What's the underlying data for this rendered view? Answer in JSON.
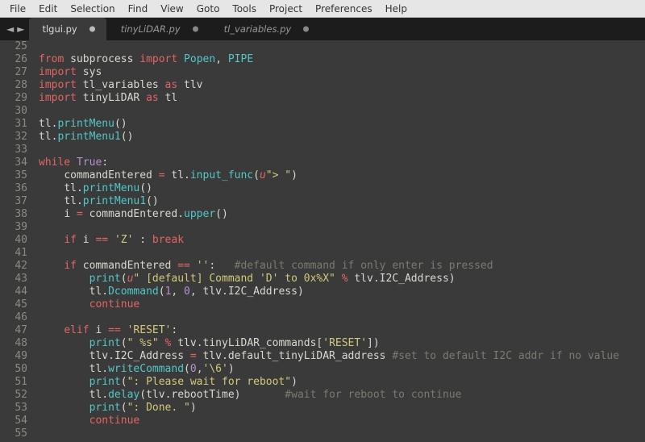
{
  "menubar": {
    "items": [
      "File",
      "Edit",
      "Selection",
      "Find",
      "View",
      "Goto",
      "Tools",
      "Project",
      "Preferences",
      "Help"
    ]
  },
  "tabbar": {
    "nav_left": "◄",
    "nav_right": "►",
    "tabs": [
      {
        "label": "tlgui.py",
        "active": true,
        "dirty": true
      },
      {
        "label": "tinyLiDAR.py",
        "active": false,
        "dirty": true
      },
      {
        "label": "tl_variables.py",
        "active": false,
        "dirty": true
      }
    ]
  },
  "editor": {
    "first_line_number": 25,
    "lines": [
      {
        "n": 25,
        "tokens": []
      },
      {
        "n": 26,
        "tokens": [
          {
            "t": "from ",
            "c": "kw"
          },
          {
            "t": "subprocess",
            "c": "id"
          },
          {
            "t": " import ",
            "c": "kw"
          },
          {
            "t": "Popen",
            "c": "cls"
          },
          {
            "t": ", ",
            "c": "id"
          },
          {
            "t": "PIPE",
            "c": "cls"
          }
        ]
      },
      {
        "n": 27,
        "tokens": [
          {
            "t": "import ",
            "c": "kw"
          },
          {
            "t": "sys",
            "c": "id"
          }
        ]
      },
      {
        "n": 28,
        "tokens": [
          {
            "t": "import ",
            "c": "kw"
          },
          {
            "t": "tl_variables",
            "c": "id"
          },
          {
            "t": " as ",
            "c": "kw"
          },
          {
            "t": "tlv",
            "c": "id"
          }
        ]
      },
      {
        "n": 29,
        "tokens": [
          {
            "t": "import ",
            "c": "kw"
          },
          {
            "t": "tinyLiDAR",
            "c": "id"
          },
          {
            "t": " as ",
            "c": "kw"
          },
          {
            "t": "tl",
            "c": "id"
          }
        ]
      },
      {
        "n": 30,
        "tokens": []
      },
      {
        "n": 31,
        "tokens": [
          {
            "t": "tl",
            "c": "id"
          },
          {
            "t": ".",
            "c": "id"
          },
          {
            "t": "printMenu",
            "c": "fnc"
          },
          {
            "t": "()",
            "c": "id"
          }
        ]
      },
      {
        "n": 32,
        "tokens": [
          {
            "t": "tl",
            "c": "id"
          },
          {
            "t": ".",
            "c": "id"
          },
          {
            "t": "printMenu1",
            "c": "fnc"
          },
          {
            "t": "()",
            "c": "id"
          }
        ]
      },
      {
        "n": 33,
        "tokens": []
      },
      {
        "n": 34,
        "tokens": [
          {
            "t": "while ",
            "c": "kw"
          },
          {
            "t": "True",
            "c": "cnst"
          },
          {
            "t": ":",
            "c": "id"
          }
        ]
      },
      {
        "n": 35,
        "tokens": [
          {
            "t": "    ",
            "c": "id"
          },
          {
            "t": "commandEntered",
            "c": "id"
          },
          {
            "t": " = ",
            "c": "op"
          },
          {
            "t": "tl",
            "c": "id"
          },
          {
            "t": ".",
            "c": "id"
          },
          {
            "t": "input_func",
            "c": "fnc"
          },
          {
            "t": "(",
            "c": "id"
          },
          {
            "t": "u",
            "c": "pfx"
          },
          {
            "t": "\"> \"",
            "c": "str"
          },
          {
            "t": ")",
            "c": "id"
          }
        ]
      },
      {
        "n": 36,
        "tokens": [
          {
            "t": "    ",
            "c": "id"
          },
          {
            "t": "tl",
            "c": "id"
          },
          {
            "t": ".",
            "c": "id"
          },
          {
            "t": "printMenu",
            "c": "fnc"
          },
          {
            "t": "()",
            "c": "id"
          }
        ]
      },
      {
        "n": 37,
        "tokens": [
          {
            "t": "    ",
            "c": "id"
          },
          {
            "t": "tl",
            "c": "id"
          },
          {
            "t": ".",
            "c": "id"
          },
          {
            "t": "printMenu1",
            "c": "fnc"
          },
          {
            "t": "()",
            "c": "id"
          }
        ]
      },
      {
        "n": 38,
        "tokens": [
          {
            "t": "    ",
            "c": "id"
          },
          {
            "t": "i",
            "c": "id"
          },
          {
            "t": " = ",
            "c": "op"
          },
          {
            "t": "commandEntered",
            "c": "id"
          },
          {
            "t": ".",
            "c": "id"
          },
          {
            "t": "upper",
            "c": "fnc"
          },
          {
            "t": "()",
            "c": "id"
          }
        ]
      },
      {
        "n": 39,
        "tokens": []
      },
      {
        "n": 40,
        "tokens": [
          {
            "t": "    ",
            "c": "id"
          },
          {
            "t": "if ",
            "c": "kw"
          },
          {
            "t": "i",
            "c": "id"
          },
          {
            "t": " == ",
            "c": "op"
          },
          {
            "t": "'Z'",
            "c": "str"
          },
          {
            "t": " : ",
            "c": "id"
          },
          {
            "t": "break",
            "c": "kw"
          }
        ]
      },
      {
        "n": 41,
        "tokens": []
      },
      {
        "n": 42,
        "tokens": [
          {
            "t": "    ",
            "c": "id"
          },
          {
            "t": "if ",
            "c": "kw"
          },
          {
            "t": "commandEntered",
            "c": "id"
          },
          {
            "t": " == ",
            "c": "op"
          },
          {
            "t": "''",
            "c": "str"
          },
          {
            "t": ":   ",
            "c": "id"
          },
          {
            "t": "#default command if only enter is pressed",
            "c": "cmt"
          }
        ]
      },
      {
        "n": 43,
        "tokens": [
          {
            "t": "        ",
            "c": "id"
          },
          {
            "t": "print",
            "c": "fnc"
          },
          {
            "t": "(",
            "c": "id"
          },
          {
            "t": "u",
            "c": "pfx"
          },
          {
            "t": "\" [default] Command 'D' to 0x%X\"",
            "c": "str"
          },
          {
            "t": " % ",
            "c": "op"
          },
          {
            "t": "tlv",
            "c": "id"
          },
          {
            "t": ".",
            "c": "id"
          },
          {
            "t": "I2C_Address",
            "c": "id"
          },
          {
            "t": ")",
            "c": "id"
          }
        ]
      },
      {
        "n": 44,
        "tokens": [
          {
            "t": "        ",
            "c": "id"
          },
          {
            "t": "tl",
            "c": "id"
          },
          {
            "t": ".",
            "c": "id"
          },
          {
            "t": "Dcommand",
            "c": "fnc"
          },
          {
            "t": "(",
            "c": "id"
          },
          {
            "t": "1",
            "c": "num"
          },
          {
            "t": ", ",
            "c": "id"
          },
          {
            "t": "0",
            "c": "num"
          },
          {
            "t": ", ",
            "c": "id"
          },
          {
            "t": "tlv",
            "c": "id"
          },
          {
            "t": ".",
            "c": "id"
          },
          {
            "t": "I2C_Address",
            "c": "id"
          },
          {
            "t": ")",
            "c": "id"
          }
        ]
      },
      {
        "n": 45,
        "tokens": [
          {
            "t": "        ",
            "c": "id"
          },
          {
            "t": "continue",
            "c": "kw"
          }
        ]
      },
      {
        "n": 46,
        "tokens": []
      },
      {
        "n": 47,
        "tokens": [
          {
            "t": "    ",
            "c": "id"
          },
          {
            "t": "elif ",
            "c": "kw"
          },
          {
            "t": "i",
            "c": "id"
          },
          {
            "t": " == ",
            "c": "op"
          },
          {
            "t": "'RESET'",
            "c": "str"
          },
          {
            "t": ":",
            "c": "id"
          }
        ]
      },
      {
        "n": 48,
        "tokens": [
          {
            "t": "        ",
            "c": "id"
          },
          {
            "t": "print",
            "c": "fnc"
          },
          {
            "t": "(",
            "c": "id"
          },
          {
            "t": "\" %s\"",
            "c": "str"
          },
          {
            "t": " % ",
            "c": "op"
          },
          {
            "t": "tlv",
            "c": "id"
          },
          {
            "t": ".",
            "c": "id"
          },
          {
            "t": "tinyLiDAR_commands",
            "c": "id"
          },
          {
            "t": "[",
            "c": "id"
          },
          {
            "t": "'RESET'",
            "c": "str"
          },
          {
            "t": "])",
            "c": "id"
          }
        ]
      },
      {
        "n": 49,
        "tokens": [
          {
            "t": "        ",
            "c": "id"
          },
          {
            "t": "tlv",
            "c": "id"
          },
          {
            "t": ".",
            "c": "id"
          },
          {
            "t": "I2C_Address",
            "c": "id"
          },
          {
            "t": " = ",
            "c": "op"
          },
          {
            "t": "tlv",
            "c": "id"
          },
          {
            "t": ".",
            "c": "id"
          },
          {
            "t": "default_tinyLiDAR_address",
            "c": "id"
          },
          {
            "t": " ",
            "c": "id"
          },
          {
            "t": "#set to default I2C addr if no value",
            "c": "cmt"
          }
        ]
      },
      {
        "n": 50,
        "tokens": [
          {
            "t": "        ",
            "c": "id"
          },
          {
            "t": "tl",
            "c": "id"
          },
          {
            "t": ".",
            "c": "id"
          },
          {
            "t": "writeCommand",
            "c": "fnc"
          },
          {
            "t": "(",
            "c": "id"
          },
          {
            "t": "0",
            "c": "num"
          },
          {
            "t": ",",
            "c": "id"
          },
          {
            "t": "'\\6'",
            "c": "str"
          },
          {
            "t": ")",
            "c": "id"
          }
        ]
      },
      {
        "n": 51,
        "tokens": [
          {
            "t": "        ",
            "c": "id"
          },
          {
            "t": "print",
            "c": "fnc"
          },
          {
            "t": "(",
            "c": "id"
          },
          {
            "t": "\": Please wait for reboot\"",
            "c": "str"
          },
          {
            "t": ")",
            "c": "id"
          }
        ]
      },
      {
        "n": 52,
        "tokens": [
          {
            "t": "        ",
            "c": "id"
          },
          {
            "t": "tl",
            "c": "id"
          },
          {
            "t": ".",
            "c": "id"
          },
          {
            "t": "delay",
            "c": "fnc"
          },
          {
            "t": "(",
            "c": "id"
          },
          {
            "t": "tlv",
            "c": "id"
          },
          {
            "t": ".",
            "c": "id"
          },
          {
            "t": "rebootTime",
            "c": "id"
          },
          {
            "t": ")       ",
            "c": "id"
          },
          {
            "t": "#wait for reboot to continue",
            "c": "cmt"
          }
        ]
      },
      {
        "n": 53,
        "tokens": [
          {
            "t": "        ",
            "c": "id"
          },
          {
            "t": "print",
            "c": "fnc"
          },
          {
            "t": "(",
            "c": "id"
          },
          {
            "t": "\": Done. \"",
            "c": "str"
          },
          {
            "t": ")",
            "c": "id"
          }
        ]
      },
      {
        "n": 54,
        "tokens": [
          {
            "t": "        ",
            "c": "id"
          },
          {
            "t": "continue",
            "c": "kw"
          }
        ]
      },
      {
        "n": 55,
        "tokens": []
      }
    ]
  }
}
